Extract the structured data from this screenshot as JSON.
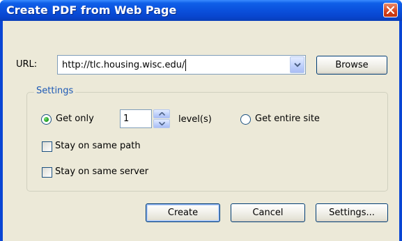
{
  "window": {
    "title": "Create PDF from Web Page",
    "close_icon": "close-icon"
  },
  "url": {
    "label": "URL:",
    "value": "http://tlc.housing.wisc.edu/",
    "dropdown_icon": "chevron-down-icon"
  },
  "browse_label": "Browse",
  "settings_group": {
    "legend": "Settings",
    "get_only_label": "Get only",
    "get_only_selected": true,
    "levels_value": "1",
    "levels_label": "level(s)",
    "entire_site_label": "Get entire site",
    "entire_site_selected": false,
    "same_path_label": "Stay on same path",
    "same_path_checked": false,
    "same_server_label": "Stay on same server",
    "same_server_checked": false
  },
  "buttons": {
    "create": "Create",
    "cancel": "Cancel",
    "settings": "Settings..."
  },
  "colors": {
    "titlebar": "#0a50dc",
    "dialog_bg": "#ece9d8",
    "legend_text": "#1e5ab5",
    "radio_selected": "#21a121",
    "close_button": "#d5421b"
  }
}
